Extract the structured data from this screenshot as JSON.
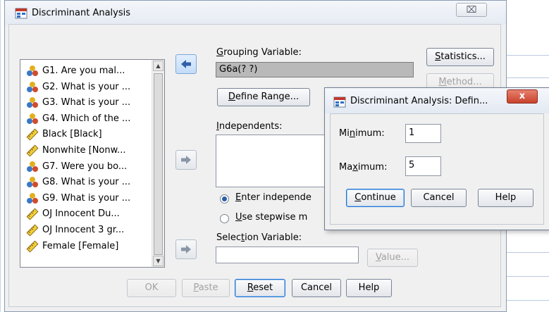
{
  "main_dialog": {
    "title": "Discriminant Analysis",
    "close_glyph": "⌧",
    "source_list": [
      {
        "label": "G1. Are you mal...",
        "icon": "nominal-icon"
      },
      {
        "label": "G2. What is your ...",
        "icon": "nominal-icon"
      },
      {
        "label": "G3. What is your ...",
        "icon": "nominal-icon"
      },
      {
        "label": "G4. Which of the ...",
        "icon": "nominal-icon"
      },
      {
        "label": "Black [Black]",
        "icon": "scale-ruler-icon"
      },
      {
        "label": "Nonwhite [Nonw...",
        "icon": "scale-ruler-icon"
      },
      {
        "label": "G7. Were you bo...",
        "icon": "nominal-icon"
      },
      {
        "label": "G8. What is your ...",
        "icon": "nominal-icon"
      },
      {
        "label": "G9. What is your ...",
        "icon": "nominal-icon"
      },
      {
        "label": "OJ Innocent Du...",
        "icon": "scale-ruler-icon"
      },
      {
        "label": "OJ Innocent 3 gr...",
        "icon": "scale-ruler-icon"
      },
      {
        "label": "Female [Female]",
        "icon": "scale-ruler-icon"
      }
    ],
    "grouping_label_pre": "",
    "grouping_label_mn": "G",
    "grouping_label_post": "rouping Variable:",
    "grouping_value": "G6a(? ?)",
    "define_range_pre": "",
    "define_range_mn": "D",
    "define_range_post": "efine Range...",
    "independents_label_pre": "",
    "independents_label_mn": "I",
    "independents_label_post": "ndependents:",
    "radio_enter_pre": "",
    "radio_enter_mn": "E",
    "radio_enter_post": "nter independe",
    "radio_stepwise_pre": "",
    "radio_stepwise_mn": "U",
    "radio_stepwise_post": "se stepwise m",
    "selection_label_pre": "Selec",
    "selection_label_mn": "t",
    "selection_label_post": "ion Variable:",
    "value_button_pre": "",
    "value_button_mn": "V",
    "value_button_post": "alue...",
    "statistics_pre": "",
    "statistics_mn": "S",
    "statistics_post": "tatistics...",
    "method_pre": "",
    "method_mn": "M",
    "method_post": "ethod...",
    "buttons": {
      "ok": "OK",
      "paste_pre": "",
      "paste_mn": "P",
      "paste_post": "aste",
      "reset_pre": "",
      "reset_mn": "R",
      "reset_post": "eset",
      "cancel": "Cancel",
      "help": "Help"
    }
  },
  "sub_dialog": {
    "title": "Discriminant Analysis: Defin...",
    "close_glyph": "x",
    "minimum_pre": "Mi",
    "minimum_mn": "n",
    "minimum_post": "imum:",
    "minimum_value": "1",
    "maximum_pre": "Ma",
    "maximum_mn": "x",
    "maximum_post": "imum:",
    "maximum_value": "5",
    "continue_pre": "",
    "continue_mn": "C",
    "continue_post": "ontinue",
    "cancel": "Cancel",
    "help": "Help"
  },
  "colors": {
    "accent_blue": "#2f6fc9",
    "title_bar": "#e6ebf3",
    "close_red": "#c8422c"
  }
}
